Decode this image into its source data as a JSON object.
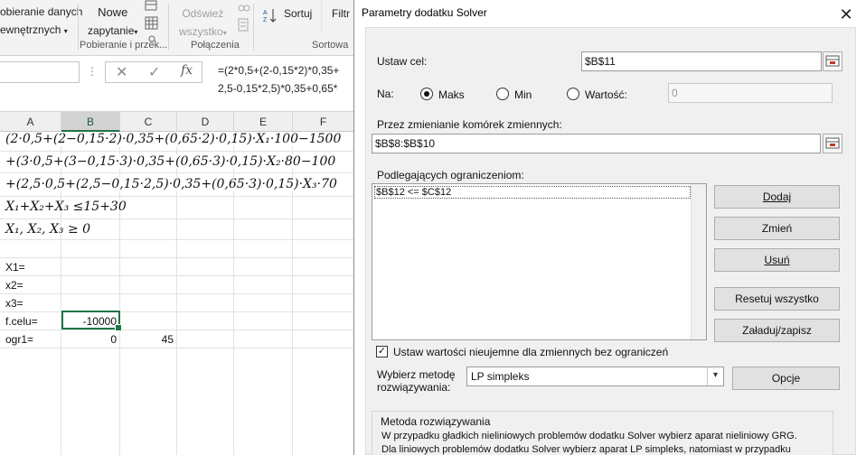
{
  "ribbon": {
    "get_data_line1": "obieranie danych",
    "get_data_line2": "ewnętrznych",
    "new_query_line1": "Nowe",
    "new_query_line2": "zapytanie",
    "refresh_line1": "Odśwież",
    "refresh_line2": "wszystko",
    "sort_label": "Sortuj",
    "filter_label": "Filtr",
    "group_get_transform": "Pobieranie i przek...",
    "group_connections": "Połączenia",
    "group_sort": "Sortowa"
  },
  "formula_bar": {
    "cancel_symbol": "✕",
    "enter_symbol": "✓",
    "fx_label": "fx",
    "line1": "=(2*0,5+(2-0,15*2)*0,35+",
    "line2": "2,5-0,15*2,5)*0,35+0,65*"
  },
  "grid": {
    "columns": [
      "A",
      "B",
      "C",
      "D",
      "E",
      "F"
    ],
    "math_rows": [
      "(2·0,5+(2−0,15·2)·0,35+(0,65·2)·0,15)·X₁·100−1500",
      "+(3·0,5+(3−0,15·3)·0,35+(0,65·3)·0,15)·X₂·80−100",
      "+(2,5·0,5+(2,5−0,15·2,5)·0,35+(0,65·3)·0,15)·X₃·70",
      "X₁+X₂+X₃ ≤15+30",
      "X₁, X₂, X₃ ≥ 0"
    ],
    "rows": [
      {
        "a": "X1=",
        "b": "",
        "c": ""
      },
      {
        "a": "x2=",
        "b": "",
        "c": ""
      },
      {
        "a": "x3=",
        "b": "",
        "c": ""
      },
      {
        "a": "f.celu=",
        "b": "-10000",
        "c": ""
      },
      {
        "a": "ogr1=",
        "b": "0",
        "c": "45"
      }
    ]
  },
  "dialog": {
    "title": "Parametry dodatku Solver",
    "close_symbol": "✕",
    "set_objective_label": "Ustaw cel:",
    "objective_value": "$B$11",
    "to_label": "Na:",
    "max_label": "Maks",
    "min_label": "Min",
    "value_of_label": "Wartość:",
    "value_of_input": "0",
    "selected_goal": "max",
    "changing_cells_label": "Przez zmienianie komórek zmiennych:",
    "changing_cells_value": "$B$8:$B$10",
    "constraints_label": "Podlegających ograniczeniom:",
    "constraints": [
      "$B$12 <= $C$12"
    ],
    "add_button": "Dodaj",
    "change_button": "Zmień",
    "delete_button": "Usuń",
    "reset_button": "Resetuj wszystko",
    "load_save_button": "Załaduj/zapisz",
    "nonnegative_label": "Ustaw wartości nieujemne dla zmiennych bez ograniczeń",
    "nonnegative_checked": true,
    "method_label_line1": "Wybierz metodę",
    "method_label_line2": "rozwiązywania:",
    "method_value": "LP simpleks",
    "options_button": "Opcje",
    "method_group_title": "Metoda rozwiązywania",
    "method_desc_line1": "W przypadku gładkich nieliniowych problemów dodatku Solver wybierz aparat nieliniowy GRG.",
    "method_desc_line2": "Dla liniowych problemów dodatku Solver wybierz aparat LP simpleks, natomiast w przypadku"
  }
}
